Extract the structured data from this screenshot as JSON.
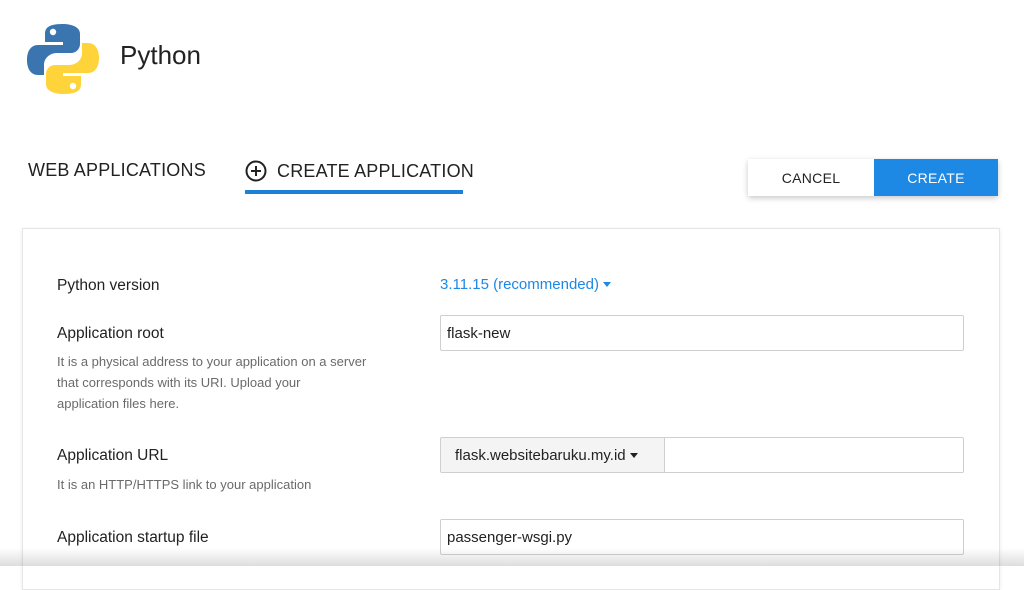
{
  "header": {
    "logo_icon": "python-logo-icon",
    "title": "Python"
  },
  "tabs": {
    "web_applications": "WEB APPLICATIONS",
    "create_application": "CREATE APPLICATION",
    "create_icon": "plus-circle-icon",
    "active": "create_application"
  },
  "actions": {
    "cancel_label": "CANCEL",
    "create_label": "CREATE"
  },
  "form": {
    "python_version": {
      "label": "Python version",
      "value": "3.11.15 (recommended)"
    },
    "app_root": {
      "label": "Application root",
      "value": "flask-new",
      "hint_lines": [
        "It is a physical address to your application on a server",
        "that corresponds with its URI. Upload your",
        "application files here."
      ]
    },
    "app_url": {
      "label": "Application URL",
      "domain": "flask.websitebaruku.my.id",
      "path": "",
      "hint": "It is an HTTP/HTTPS link to your application"
    },
    "startup_file": {
      "label": "Application startup file",
      "value": "passenger-wsgi.py"
    }
  },
  "colors": {
    "accent": "#1e88e5",
    "underline": "#1e7fd6",
    "python_blue": "#3a75b0",
    "python_yellow": "#ffd43b"
  }
}
